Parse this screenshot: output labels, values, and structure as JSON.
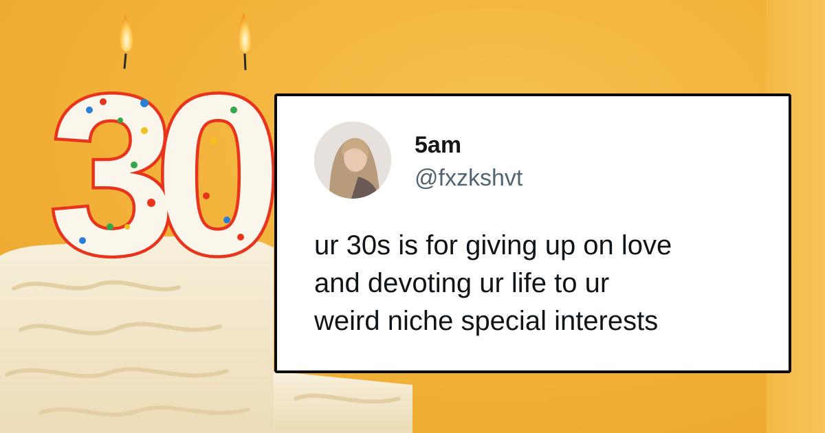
{
  "tweet": {
    "display_name": "5am",
    "handle": "@fxzkshvt",
    "text_lines": [
      "ur 30s is for giving up on love",
      "and devoting ur life to ur",
      "weird niche special interests"
    ]
  },
  "candle": {
    "digits": "30"
  },
  "colors": {
    "background": "#f2b138",
    "frosting": "#f4ead3",
    "candle_outline": "#e8341c",
    "card_border": "#0a0a0a"
  },
  "icons": [
    "avatar-photo",
    "candle-flame"
  ]
}
